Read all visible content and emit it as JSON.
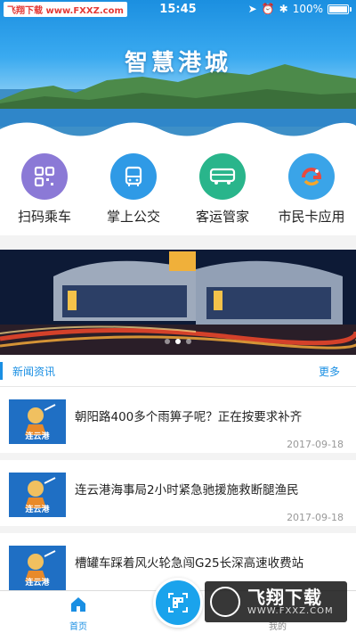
{
  "status_bar": {
    "watermark": "飞翔下载 www.FXXZ.com",
    "time": "15:45",
    "battery": "100%"
  },
  "app": {
    "title": "智慧港城"
  },
  "quick_actions": [
    {
      "label": "扫码乘车",
      "icon": "qr-scan-icon",
      "color": "#8b79d6"
    },
    {
      "label": "掌上公交",
      "icon": "bus-icon",
      "color": "#2f9ae6"
    },
    {
      "label": "客运管家",
      "icon": "coach-icon",
      "color": "#29b58b"
    },
    {
      "label": "市民卡应用",
      "icon": "citizen-card-icon",
      "color": "#3aa4e8"
    }
  ],
  "banner": {
    "dots": 3,
    "active_dot": 1
  },
  "news": {
    "section_title": "新闻资讯",
    "more_label": "更多",
    "thumb_caption": "连云港",
    "items": [
      {
        "title": "朝阳路400多个雨箅子呢？正在按要求补齐",
        "date": "2017-09-18"
      },
      {
        "title": "连云港海事局2小时紧急驰援施救断腿渔民",
        "date": "2017-09-18"
      },
      {
        "title": "槽罐车踩着风火轮急闯G25长深高速收费站",
        "date": ""
      }
    ]
  },
  "tab_bar": {
    "home_label": "首页",
    "mine_label": "我的",
    "accent": "#1a8fe3"
  },
  "overlay_watermark": {
    "text": "飞翔下载",
    "url": "WWW.FXXZ.COM"
  }
}
